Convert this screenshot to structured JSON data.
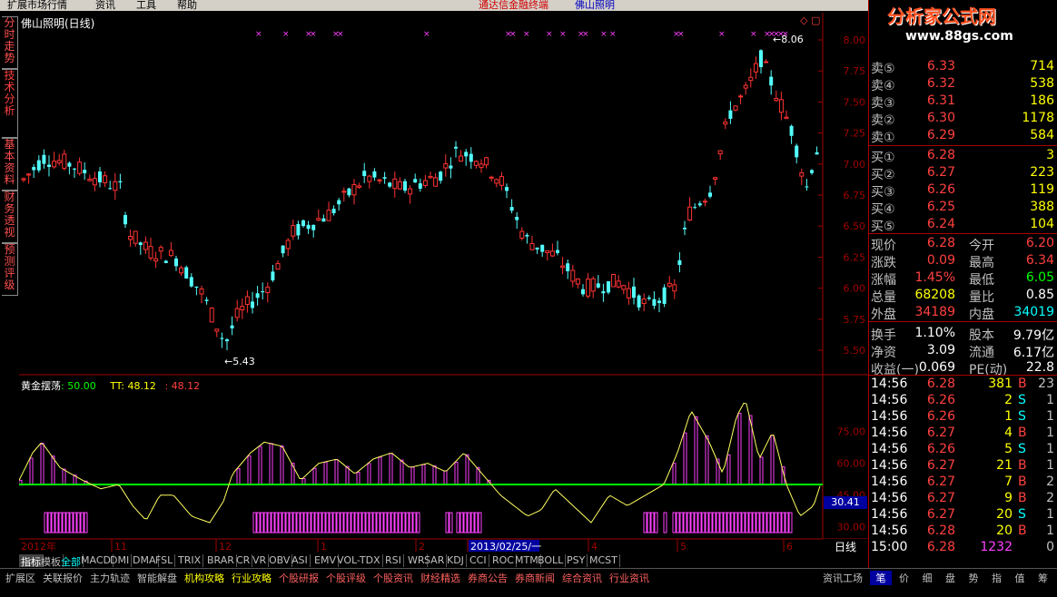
{
  "menubar": {
    "items": [
      "扩展市场行情",
      "资讯",
      "工具",
      "帮助"
    ],
    "broker": "通达信金融终端",
    "stock_name": "佛山照明"
  },
  "left_tabs": [
    "分时走势",
    "技术分析",
    "基本资料",
    "财务透视",
    "预测评级"
  ],
  "chart": {
    "title": "佛山照明(日线)",
    "price_axis": [
      "8.00",
      "7.75",
      "7.50",
      "7.25",
      "7.00",
      "6.75",
      "6.50",
      "6.25",
      "6.00",
      "5.75",
      "5.50"
    ],
    "high_label": "8.06",
    "low_label": "5.43",
    "indicator_name": "黄金摆荡",
    "indicator_v1_label": ": 50.00",
    "indicator_tt_label": "TT: 48.12",
    "indicator_v3_label": ": 48.12",
    "indicator_axis": [
      "75.00",
      "60.00",
      "45.00",
      "30.00"
    ],
    "indicator_current": "30.41",
    "date_labels": [
      "2012年",
      "11",
      "12",
      "1",
      "2",
      "2013/02/25/一",
      "4",
      "5",
      "6"
    ],
    "period": "日线"
  },
  "chart_data": {
    "type": "candlestick",
    "price_high": 8.06,
    "price_low": 5.43,
    "ylim": [
      5.4,
      8.1
    ],
    "indicator_ylim": [
      25,
      95
    ]
  },
  "indicator_tabs": [
    "指标",
    "模板",
    "全部",
    "MACD",
    "DMI",
    "DMA",
    "FSL",
    "TRIX",
    "BRAR",
    "CR",
    "VR",
    "OBV",
    "ASI",
    "EMV",
    "VOL-TDX",
    "RSI",
    "WR",
    "SAR",
    "KDJ",
    "CCI",
    "ROC",
    "MTM",
    "BOLL",
    "PSY",
    "MCST"
  ],
  "bottom_tabs": [
    "扩展区",
    "关联报价",
    "主力轨迹",
    "智能解盘",
    "机构攻略",
    "行业攻略",
    "个股研报",
    "个股评级",
    "个股资讯",
    "财经精选",
    "券商公告",
    "券商新闻",
    "综合资讯",
    "行业资讯"
  ],
  "right_bottom_tabs": [
    "资讯工场",
    "笔",
    "价",
    "细",
    "盘",
    "势",
    "指",
    "值",
    "筹"
  ],
  "order_book": {
    "sell": [
      {
        "label": "卖⑤",
        "price": "6.33",
        "vol": "714"
      },
      {
        "label": "卖④",
        "price": "6.32",
        "vol": "538"
      },
      {
        "label": "卖③",
        "price": "6.31",
        "vol": "186"
      },
      {
        "label": "卖②",
        "price": "6.30",
        "vol": "1178"
      },
      {
        "label": "卖①",
        "price": "6.29",
        "vol": "584"
      }
    ],
    "buy": [
      {
        "label": "买①",
        "price": "6.28",
        "vol": "3"
      },
      {
        "label": "买②",
        "price": "6.27",
        "vol": "223"
      },
      {
        "label": "买③",
        "price": "6.26",
        "vol": "119"
      },
      {
        "label": "买④",
        "price": "6.25",
        "vol": "388"
      },
      {
        "label": "买⑤",
        "price": "6.24",
        "vol": "104"
      }
    ]
  },
  "quote": {
    "rows": [
      {
        "k1": "现价",
        "v1": "6.28",
        "k2": "今开",
        "v2": "6.20"
      },
      {
        "k1": "涨跌",
        "v1": "0.09",
        "k2": "最高",
        "v2": "6.34"
      },
      {
        "k1": "涨幅",
        "v1": "1.45%",
        "k2": "最低",
        "v2": "6.05"
      },
      {
        "k1": "总量",
        "v1": "68208",
        "k2": "量比",
        "v2": "0.85"
      },
      {
        "k1": "外盘",
        "v1": "34189",
        "k2": "内盘",
        "v2": "34019"
      },
      {
        "k1": "换手",
        "v1": "1.10%",
        "k2": "股本",
        "v2": "9.79亿"
      },
      {
        "k1": "净资",
        "v1": "3.09",
        "k2": "流通",
        "v2": "6.17亿"
      },
      {
        "k1": "收益(一)",
        "v1": "0.069",
        "k2": "PE(动)",
        "v2": "22.8"
      }
    ]
  },
  "ticks": [
    {
      "t": "14:56",
      "p": "6.28",
      "v": "381",
      "s": "B",
      "n": "23"
    },
    {
      "t": "14:56",
      "p": "6.26",
      "v": "2",
      "s": "S",
      "n": "1"
    },
    {
      "t": "14:56",
      "p": "6.26",
      "v": "1",
      "s": "S",
      "n": "1"
    },
    {
      "t": "14:56",
      "p": "6.27",
      "v": "4",
      "s": "B",
      "n": "1"
    },
    {
      "t": "14:56",
      "p": "6.26",
      "v": "5",
      "s": "S",
      "n": "1"
    },
    {
      "t": "14:56",
      "p": "6.27",
      "v": "21",
      "s": "B",
      "n": "1"
    },
    {
      "t": "14:56",
      "p": "6.27",
      "v": "7",
      "s": "B",
      "n": "2"
    },
    {
      "t": "14:56",
      "p": "6.27",
      "v": "9",
      "s": "B",
      "n": "2"
    },
    {
      "t": "14:56",
      "p": "6.27",
      "v": "20",
      "s": "S",
      "n": "1"
    },
    {
      "t": "14:56",
      "p": "6.28",
      "v": "20",
      "s": "B",
      "n": "1"
    },
    {
      "t": "15:00",
      "p": "6.28",
      "v": "1232",
      "s": "",
      "n": "0"
    }
  ],
  "watermark": {
    "main": "分析家公式网",
    "url": "www.88gs.com"
  }
}
